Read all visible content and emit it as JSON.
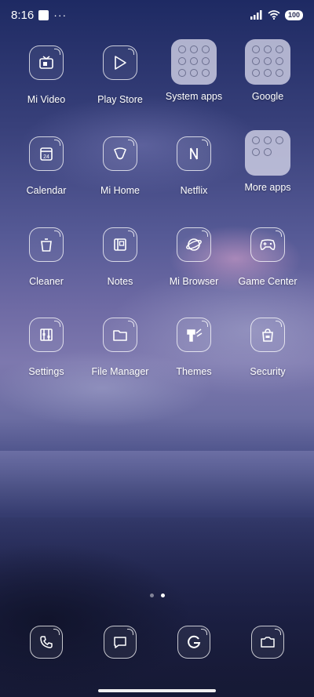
{
  "status_bar": {
    "time": "8:16",
    "more_indicator": "···",
    "battery": "100"
  },
  "apps": [
    {
      "label": "Mi Video",
      "icon": "mi-video-icon"
    },
    {
      "label": "Play Store",
      "icon": "play-store-icon"
    },
    {
      "label": "System apps",
      "icon": "folder-icon"
    },
    {
      "label": "Google",
      "icon": "folder-icon"
    },
    {
      "label": "Calendar",
      "icon": "calendar-icon",
      "date": "24"
    },
    {
      "label": "Mi Home",
      "icon": "mi-home-icon"
    },
    {
      "label": "Netflix",
      "icon": "netflix-icon"
    },
    {
      "label": "More apps",
      "icon": "folder-icon"
    },
    {
      "label": "Cleaner",
      "icon": "trash-icon"
    },
    {
      "label": "Notes",
      "icon": "notes-icon"
    },
    {
      "label": "Mi Browser",
      "icon": "browser-icon"
    },
    {
      "label": "Game Center",
      "icon": "gamepad-icon"
    },
    {
      "label": "Settings",
      "icon": "settings-icon"
    },
    {
      "label": "File Manager",
      "icon": "folder-file-icon"
    },
    {
      "label": "Themes",
      "icon": "brush-icon"
    },
    {
      "label": "Security",
      "icon": "security-bag-icon"
    }
  ],
  "dock": [
    {
      "name": "phone",
      "icon": "phone-icon"
    },
    {
      "name": "messages",
      "icon": "message-icon"
    },
    {
      "name": "chrome",
      "icon": "chrome-icon"
    },
    {
      "name": "camera",
      "icon": "camera-icon"
    }
  ],
  "page_indicator": {
    "pages": 2,
    "active": 2
  }
}
